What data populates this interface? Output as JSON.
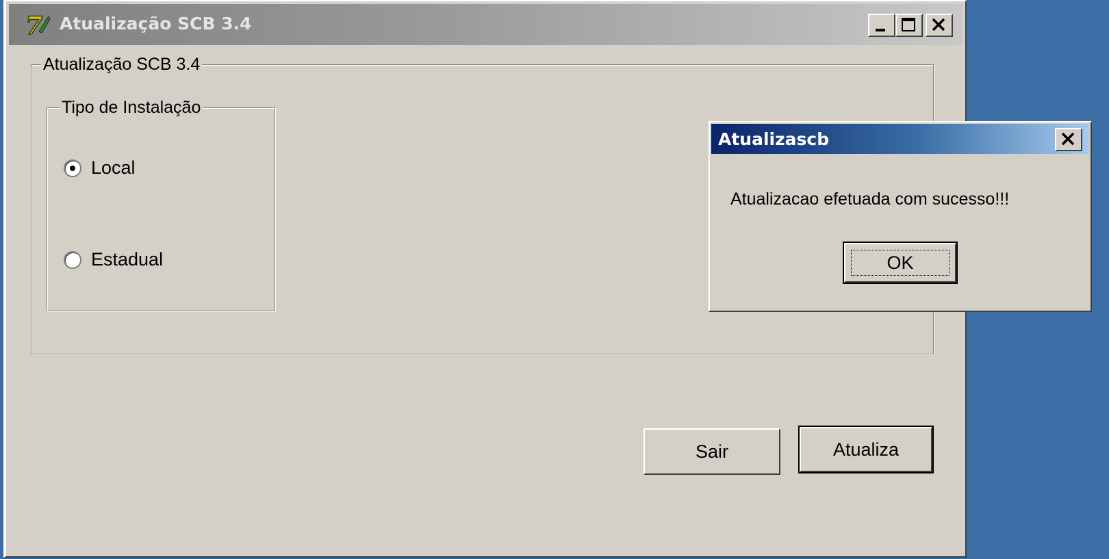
{
  "window": {
    "title": "Atualização SCB 3.4",
    "icon": "app-7-icon",
    "controls": [
      "minimize-icon",
      "maximize-icon",
      "close-icon"
    ]
  },
  "main_group": {
    "label": "Atualização SCB 3.4"
  },
  "install_type": {
    "label": "Tipo de Instalação",
    "options": [
      {
        "label": "Local",
        "selected": true
      },
      {
        "label": "Estadual",
        "selected": false
      }
    ]
  },
  "buttons": {
    "exit_label": "Sair",
    "update_label": "Atualiza"
  },
  "dialog": {
    "title": "Atualizascb",
    "message": "Atualizacao efetuada com sucesso!!!",
    "ok_label": "OK"
  },
  "colors": {
    "desktop": "#3a6ea5",
    "face": "#d4d0c8",
    "dialog_title_start": "#0a246a",
    "inactive_title": "#808080"
  }
}
